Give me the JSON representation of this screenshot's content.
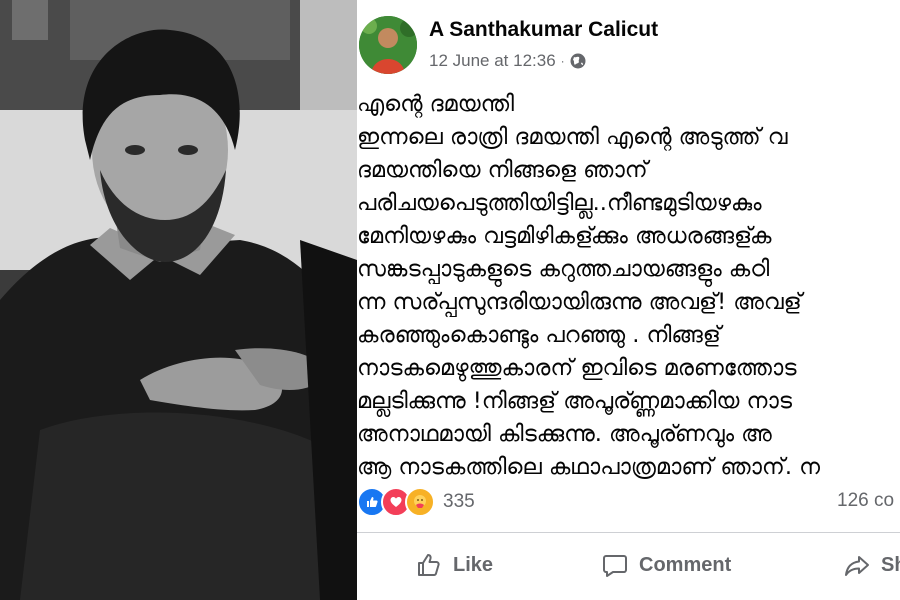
{
  "post": {
    "author": "A Santhakumar Calicut",
    "timestamp": "12 June at 12:36",
    "separator": "·",
    "lines": [
      "എന്റെ ദമയന്തി",
      "ഇന്നലെ രാത്രി ദമയന്തി എന്റെ അടുത്ത് വ",
      "ദമയന്തിയെ നിങ്ങളെ ഞാന്",
      "പരിചയപെടുത്തിയിട്ടില്ല..നീണ്ടമുടിയഴകും",
      "മേനിയഴകും വട്ടമിഴികള്ക്കും അധരങ്ങള്ക",
      "സങ്കടപ്പാടുകളുടെ കറുത്തചായങ്ങളും കഠി",
      "ന്ന സര്പ്പസുന്ദരിയായിരുന്നു അവള്! അവള്",
      "കരഞ്ഞുംകൊണ്ടും പറഞ്ഞു . നിങ്ങള്",
      "നാടകമെഴുത്തുകാരന് ഇവിടെ മരണത്തോട",
      "മല്ലടിക്കുന്നു !നിങ്ങള് അപൂര്ണ്ണമാക്കിയ നാട",
      "അനാഥമായി കിടക്കുന്നു. അപൂര്ണവും അ",
      "ആ നാടകത്തിലെ കഥാപാത്രമാണ് ഞാന്. ന"
    ],
    "reaction_count": "335",
    "comment_count": "126 co"
  },
  "actions": {
    "like": "Like",
    "comment": "Comment",
    "share": "Sh"
  },
  "colors": {
    "text": "#050505",
    "secondary": "#65676b",
    "like_blue": "#1877f2",
    "love_red": "#f33e58",
    "care_yellow": "#f7b125"
  }
}
